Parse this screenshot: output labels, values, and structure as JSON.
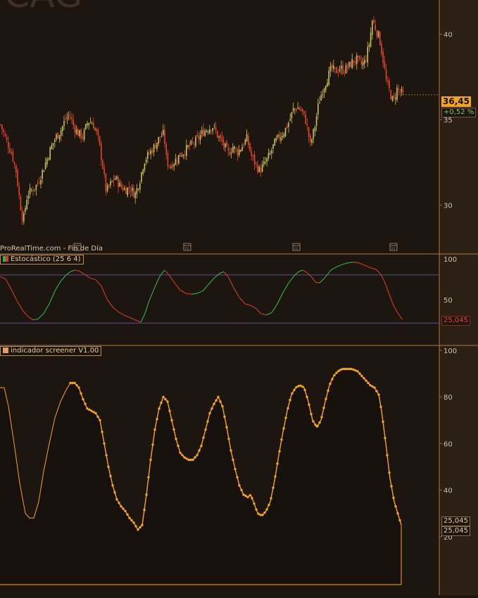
{
  "header": {
    "brand_text": "ProRealTime.com - Fin de Día",
    "title_fragment": "CAG"
  },
  "colors": {
    "background": "#1d1610",
    "panel_right": "#2c1f14",
    "separator": "#b07a45",
    "candle_up": "#c9c25a",
    "candle_down": "#e5452e",
    "stoch_up": "#2fb34a",
    "stoch_down": "#d23a2a",
    "osc_line": "#f6a51b",
    "guide_line": "#5a4d8c"
  },
  "price_panel": {
    "last_price": "36,45",
    "change_pct": "+0,52 %"
  },
  "stoch_panel": {
    "legend": "Estocástico (25 6 4)",
    "last_value": "25,045"
  },
  "screener_panel": {
    "legend": "indicador screener V1.00",
    "last_value_1": "25,045",
    "last_value_2": "25,045"
  },
  "chart_data": [
    {
      "type": "candlestick",
      "ylim": [
        28,
        42
      ],
      "yticks": [
        30,
        35,
        40
      ],
      "close_trend": [
        [
          0,
          34.7
        ],
        [
          8,
          33.8
        ],
        [
          16,
          33.0
        ],
        [
          22,
          32.0
        ],
        [
          27,
          30.3
        ],
        [
          32,
          29.0
        ],
        [
          38,
          30.6
        ],
        [
          45,
          30.9
        ],
        [
          52,
          31.2
        ],
        [
          58,
          31.8
        ],
        [
          65,
          32.6
        ],
        [
          72,
          33.4
        ],
        [
          79,
          34.0
        ],
        [
          86,
          34.4
        ],
        [
          92,
          35.0
        ],
        [
          98,
          35.3
        ],
        [
          104,
          34.6
        ],
        [
          110,
          34.2
        ],
        [
          117,
          34.0
        ],
        [
          124,
          34.9
        ],
        [
          131,
          34.8
        ],
        [
          138,
          34.0
        ],
        [
          144,
          32.6
        ],
        [
          150,
          30.8
        ],
        [
          156,
          31.2
        ],
        [
          163,
          31.6
        ],
        [
          170,
          31.1
        ],
        [
          177,
          30.9
        ],
        [
          184,
          31.0
        ],
        [
          191,
          30.6
        ],
        [
          198,
          31.5
        ],
        [
          204,
          32.6
        ],
        [
          211,
          33.0
        ],
        [
          218,
          33.4
        ],
        [
          225,
          33.9
        ],
        [
          232,
          34.2
        ],
        [
          236,
          32.5
        ],
        [
          242,
          32.3
        ],
        [
          248,
          32.6
        ],
        [
          254,
          32.9
        ],
        [
          260,
          33.1
        ],
        [
          267,
          33.4
        ],
        [
          274,
          33.6
        ],
        [
          281,
          33.9
        ],
        [
          288,
          34.3
        ],
        [
          295,
          34.5
        ],
        [
          302,
          34.6
        ],
        [
          309,
          34.0
        ],
        [
          316,
          33.6
        ],
        [
          323,
          33.0
        ],
        [
          330,
          33.4
        ],
        [
          337,
          33.1
        ],
        [
          344,
          33.5
        ],
        [
          350,
          33.9
        ],
        [
          356,
          32.9
        ],
        [
          362,
          32.4
        ],
        [
          368,
          32.0
        ],
        [
          375,
          32.4
        ],
        [
          382,
          32.9
        ],
        [
          389,
          33.6
        ],
        [
          396,
          34.0
        ],
        [
          403,
          34.3
        ],
        [
          410,
          34.9
        ],
        [
          416,
          35.6
        ],
        [
          422,
          35.7
        ],
        [
          428,
          35.5
        ],
        [
          434,
          34.9
        ],
        [
          440,
          33.5
        ],
        [
          446,
          34.5
        ],
        [
          452,
          36.0
        ],
        [
          458,
          36.8
        ],
        [
          464,
          37.4
        ],
        [
          470,
          38.0
        ],
        [
          476,
          37.8
        ],
        [
          482,
          38.0
        ],
        [
          488,
          37.9
        ],
        [
          494,
          38.1
        ],
        [
          500,
          38.4
        ],
        [
          506,
          38.5
        ],
        [
          512,
          38.2
        ],
        [
          518,
          38.4
        ],
        [
          524,
          39.5
        ],
        [
          528,
          40.8
        ],
        [
          533,
          40.3
        ],
        [
          538,
          39.8
        ],
        [
          543,
          38.6
        ],
        [
          548,
          37.2
        ],
        [
          553,
          36.6
        ],
        [
          558,
          36.0
        ],
        [
          563,
          36.8
        ],
        [
          568,
          36.6
        ],
        [
          572,
          36.45
        ]
      ]
    },
    {
      "type": "line",
      "title": "Estocástico (25 6 4)",
      "ylim": [
        0,
        100
      ],
      "yticks": [
        100,
        50
      ],
      "levels": [
        80,
        20
      ],
      "points": [
        [
          0,
          78
        ],
        [
          8,
          75
        ],
        [
          16,
          62
        ],
        [
          24,
          48
        ],
        [
          32,
          36
        ],
        [
          40,
          28
        ],
        [
          47,
          24
        ],
        [
          54,
          25
        ],
        [
          62,
          32
        ],
        [
          70,
          44
        ],
        [
          78,
          60
        ],
        [
          86,
          72
        ],
        [
          94,
          80
        ],
        [
          100,
          84
        ],
        [
          106,
          86
        ],
        [
          112,
          85
        ],
        [
          120,
          81
        ],
        [
          128,
          76
        ],
        [
          136,
          74
        ],
        [
          144,
          66
        ],
        [
          152,
          50
        ],
        [
          160,
          40
        ],
        [
          168,
          34
        ],
        [
          176,
          30
        ],
        [
          184,
          27
        ],
        [
          192,
          24
        ],
        [
          200,
          21
        ],
        [
          206,
          32
        ],
        [
          212,
          48
        ],
        [
          220,
          65
        ],
        [
          228,
          80
        ],
        [
          234,
          86
        ],
        [
          240,
          80
        ],
        [
          248,
          70
        ],
        [
          256,
          61
        ],
        [
          264,
          57
        ],
        [
          272,
          56
        ],
        [
          280,
          57
        ],
        [
          288,
          60
        ],
        [
          296,
          68
        ],
        [
          304,
          76
        ],
        [
          312,
          82
        ],
        [
          318,
          84
        ],
        [
          324,
          78
        ],
        [
          332,
          64
        ],
        [
          340,
          52
        ],
        [
          348,
          44
        ],
        [
          356,
          42
        ],
        [
          364,
          38
        ],
        [
          370,
          32
        ],
        [
          378,
          30
        ],
        [
          386,
          33
        ],
        [
          394,
          44
        ],
        [
          402,
          58
        ],
        [
          410,
          70
        ],
        [
          418,
          79
        ],
        [
          424,
          84
        ],
        [
          430,
          86
        ],
        [
          436,
          83
        ],
        [
          442,
          78
        ],
        [
          448,
          71
        ],
        [
          454,
          70
        ],
        [
          462,
          77
        ],
        [
          470,
          86
        ],
        [
          478,
          90
        ],
        [
          486,
          93
        ],
        [
          494,
          95
        ],
        [
          502,
          96
        ],
        [
          510,
          95
        ],
        [
          518,
          92
        ],
        [
          526,
          89
        ],
        [
          534,
          87
        ],
        [
          540,
          82
        ],
        [
          546,
          72
        ],
        [
          552,
          58
        ],
        [
          558,
          44
        ],
        [
          564,
          34
        ],
        [
          570,
          26
        ],
        [
          572,
          25.045
        ]
      ]
    },
    {
      "type": "line",
      "title": "indicador screener V1.00",
      "ylim": [
        0,
        100
      ],
      "yticks": [
        100,
        80,
        60,
        40,
        20
      ],
      "points": [
        [
          0,
          84
        ],
        [
          6,
          84
        ],
        [
          12,
          76
        ],
        [
          20,
          60
        ],
        [
          28,
          43
        ],
        [
          36,
          30
        ],
        [
          42,
          28
        ],
        [
          48,
          28
        ],
        [
          55,
          35
        ],
        [
          62,
          48
        ],
        [
          70,
          60
        ],
        [
          78,
          71
        ],
        [
          86,
          78
        ],
        [
          94,
          83
        ],
        [
          100,
          86
        ],
        [
          106,
          86
        ],
        [
          112,
          84
        ],
        [
          118,
          79
        ],
        [
          124,
          75
        ],
        [
          130,
          74
        ],
        [
          136,
          73
        ],
        [
          142,
          70
        ],
        [
          148,
          60
        ],
        [
          154,
          50
        ],
        [
          160,
          42
        ],
        [
          166,
          36
        ],
        [
          172,
          33
        ],
        [
          178,
          31
        ],
        [
          184,
          28
        ],
        [
          190,
          26
        ],
        [
          196,
          23
        ],
        [
          202,
          25
        ],
        [
          208,
          38
        ],
        [
          214,
          53
        ],
        [
          220,
          66
        ],
        [
          226,
          75
        ],
        [
          232,
          80
        ],
        [
          238,
          78
        ],
        [
          244,
          70
        ],
        [
          250,
          62
        ],
        [
          256,
          56
        ],
        [
          262,
          54
        ],
        [
          268,
          53
        ],
        [
          274,
          53
        ],
        [
          280,
          55
        ],
        [
          286,
          59
        ],
        [
          292,
          66
        ],
        [
          298,
          73
        ],
        [
          304,
          77
        ],
        [
          310,
          80
        ],
        [
          316,
          76
        ],
        [
          322,
          67
        ],
        [
          328,
          57
        ],
        [
          334,
          49
        ],
        [
          340,
          42
        ],
        [
          346,
          38
        ],
        [
          352,
          37
        ],
        [
          356,
          38
        ],
        [
          360,
          35
        ],
        [
          366,
          30
        ],
        [
          372,
          29
        ],
        [
          378,
          31
        ],
        [
          384,
          35
        ],
        [
          390,
          44
        ],
        [
          396,
          55
        ],
        [
          402,
          65
        ],
        [
          408,
          74
        ],
        [
          414,
          81
        ],
        [
          420,
          84
        ],
        [
          426,
          85
        ],
        [
          432,
          84
        ],
        [
          438,
          78
        ],
        [
          444,
          70
        ],
        [
          450,
          67
        ],
        [
          456,
          70
        ],
        [
          462,
          78
        ],
        [
          468,
          85
        ],
        [
          474,
          89
        ],
        [
          480,
          91
        ],
        [
          486,
          92
        ],
        [
          492,
          92
        ],
        [
          500,
          92
        ],
        [
          508,
          91
        ],
        [
          514,
          89
        ],
        [
          520,
          87
        ],
        [
          526,
          85
        ],
        [
          532,
          84
        ],
        [
          538,
          81
        ],
        [
          542,
          74
        ],
        [
          548,
          60
        ],
        [
          554,
          45
        ],
        [
          560,
          35
        ],
        [
          566,
          29
        ],
        [
          570,
          25.045
        ]
      ]
    }
  ]
}
